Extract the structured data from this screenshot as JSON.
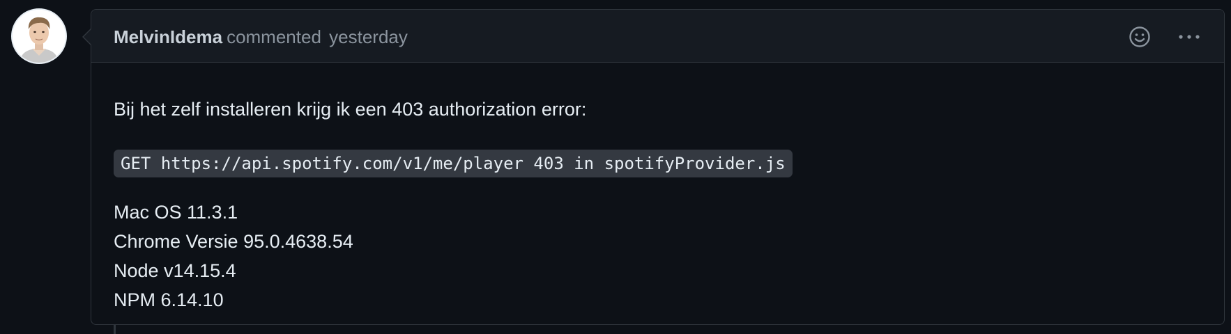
{
  "comment": {
    "author": "MelvinIdema",
    "action": "commented",
    "time": "yesterday",
    "body": {
      "intro": "Bij het zelf installeren krijg ik een 403 authorization error:",
      "code": "GET https://api.spotify.com/v1/me/player 403 in spotifyProvider.js",
      "specs": [
        "Mac OS 11.3.1",
        "Chrome Versie 95.0.4638.54",
        "Node v14.15.4",
        "NPM 6.14.10"
      ]
    },
    "icons": {
      "emoji": "smiley-icon",
      "more": "kebab-horizontal-icon",
      "avatar": "user-avatar"
    }
  },
  "colors": {
    "background": "#0d1117",
    "header_bg": "#161b22",
    "border": "#30363d",
    "text_primary": "#e6edf3",
    "text_muted": "#8b949e",
    "code_bg": "#343941"
  }
}
